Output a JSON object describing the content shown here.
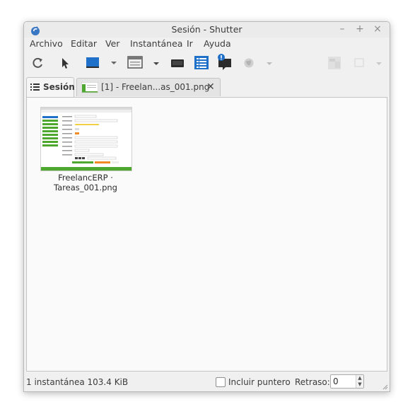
{
  "window": {
    "title": "Sesión - Shutter"
  },
  "menu": [
    "Archivo",
    "Editar",
    "Ver",
    "Instantánea",
    "Ir",
    "Ayuda"
  ],
  "toolbar_icons": [
    "refresh-icon",
    "pointer-icon",
    "selection-icon",
    "window-icon",
    "desktop-icon",
    "menu-icon",
    "tooltip-icon",
    "web-icon"
  ],
  "tabs": {
    "session": "Sesión",
    "file": "[1] - Freelan...as_001.png"
  },
  "thumbnail": {
    "label_line1": "FreelancERP ·",
    "label_line2": "Tareas_001.png"
  },
  "status": {
    "summary": "1 instantánea  103.4 KiB",
    "include_pointer": "Incluir puntero",
    "include_pointer_checked": false,
    "delay_label": "Retraso:",
    "delay_value": "0"
  },
  "colors": {
    "accent_blue": "#1e70c8",
    "green": "#4ea72e",
    "orange": "#f08a24"
  }
}
